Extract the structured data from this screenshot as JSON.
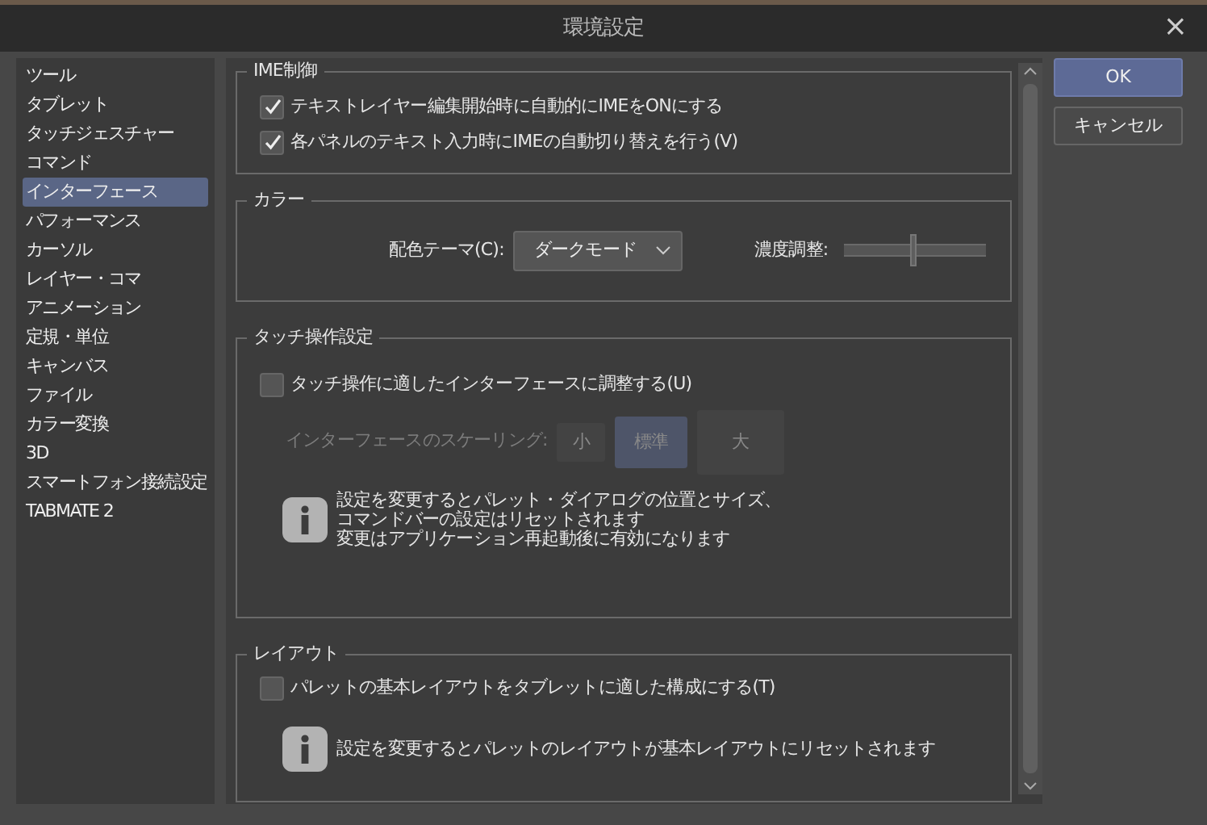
{
  "window": {
    "title": "環境設定",
    "close": "×"
  },
  "sidebar": {
    "items": [
      {
        "label": "ツール",
        "selected": false
      },
      {
        "label": "タブレット",
        "selected": false
      },
      {
        "label": "タッチジェスチャー",
        "selected": false
      },
      {
        "label": "コマンド",
        "selected": false
      },
      {
        "label": "インターフェース",
        "selected": true
      },
      {
        "label": "パフォーマンス",
        "selected": false
      },
      {
        "label": "カーソル",
        "selected": false
      },
      {
        "label": "レイヤー・コマ",
        "selected": false
      },
      {
        "label": "アニメーション",
        "selected": false
      },
      {
        "label": "定規・単位",
        "selected": false
      },
      {
        "label": "キャンバス",
        "selected": false
      },
      {
        "label": "ファイル",
        "selected": false
      },
      {
        "label": "カラー変換",
        "selected": false
      },
      {
        "label": "3D",
        "selected": false
      },
      {
        "label": "スマートフォン接続設定",
        "selected": false
      },
      {
        "label": "TABMATE 2",
        "selected": false
      }
    ]
  },
  "ime": {
    "title": "IME制御",
    "options": [
      {
        "label": "テキストレイヤー編集開始時に自動的にIMEをONにする",
        "checked": true
      },
      {
        "label": "各パネルのテキスト入力時にIMEの自動切り替えを行う(V)",
        "checked": true
      }
    ]
  },
  "color": {
    "title": "カラー",
    "theme_label": "配色テーマ(C):",
    "theme_value": "ダークモード",
    "density_label": "濃度調整:",
    "density": {
      "level": 0.49
    }
  },
  "touch": {
    "title": "タッチ操作設定",
    "option": {
      "label": "タッチ操作に適したインターフェースに調整する(U)",
      "checked": false
    },
    "scaling": {
      "label": "インターフェースのスケーリング:",
      "disabled": true,
      "options": [
        {
          "label": "小",
          "selected": false
        },
        {
          "label": "標準",
          "selected": true
        },
        {
          "label": "大",
          "selected": false
        }
      ]
    },
    "info": [
      "設定を変更するとパレット・ダイアログの位置とサイズ、",
      "コマンドバーの設定はリセットされます",
      "変更はアプリケーション再起動後に有効になります"
    ]
  },
  "layout": {
    "title": "レイアウト",
    "option": {
      "label": "パレットの基本レイアウトをタブレットに適した構成にする(T)",
      "checked": false
    },
    "info": [
      "設定を変更するとパレットのレイアウトが基本レイアウトにリセットされます"
    ]
  },
  "buttons": [
    {
      "label": "OK",
      "primary": true
    },
    {
      "label": "キャンセル",
      "primary": false
    }
  ]
}
